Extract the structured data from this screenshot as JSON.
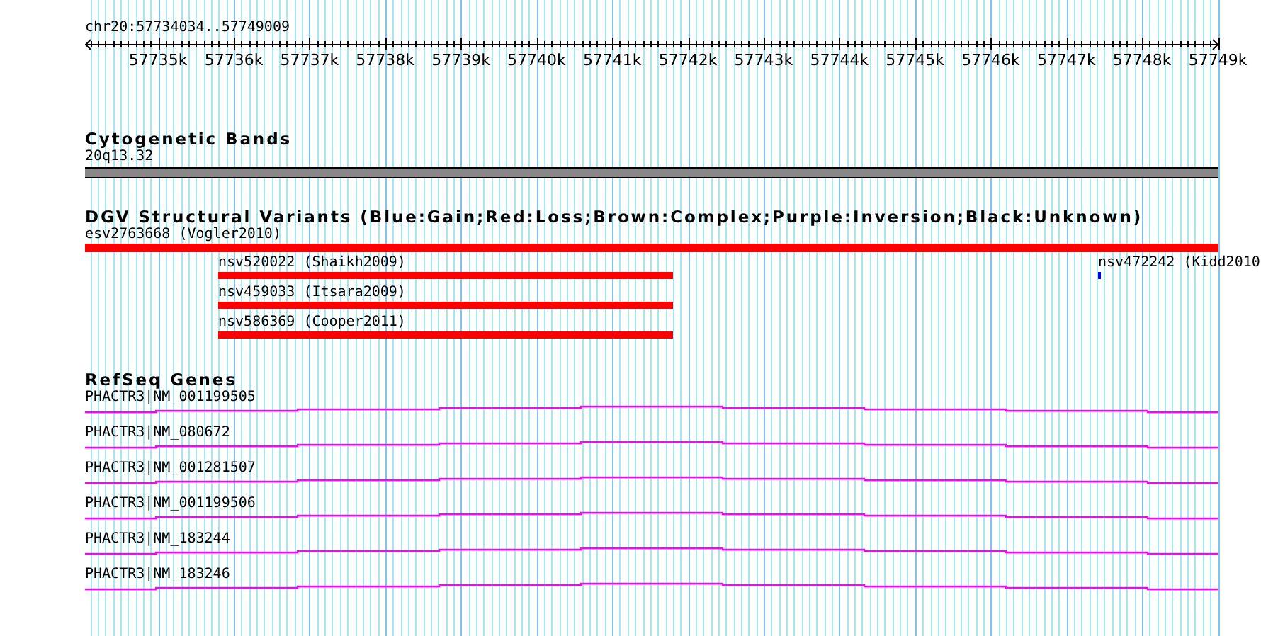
{
  "position": "chr20:57734034..57749009",
  "ruler": {
    "ticks": [
      "57735k",
      "57736k",
      "57737k",
      "57738k",
      "57739k",
      "57740k",
      "57741k",
      "57742k",
      "57743k",
      "57744k",
      "57745k",
      "57746k",
      "57747k",
      "57748k",
      "57749k"
    ]
  },
  "tracks": [
    {
      "kind": "bands",
      "title": "Cytogenetic Bands",
      "rows": [
        [
          {
            "label": "20q13.32"
          }
        ]
      ]
    },
    {
      "kind": "variants",
      "title": "DGV Structural Variants (Blue:Gain;Red:Loss;Brown:Complex;Purple:Inversion;Black:Unknown)",
      "rows": [
        [
          {
            "label": "esv2763668 (Vogler2010)",
            "color": "#ff0000"
          }
        ],
        [
          {
            "label": "nsv520022 (Shaikh2009)",
            "color": "#ff0000"
          },
          {
            "label": "nsv472242 (Kidd2010",
            "color": "#0000ff"
          }
        ],
        [
          {
            "label": "nsv459033 (Itsara2009)",
            "color": "#ff0000"
          }
        ],
        [
          {
            "label": "nsv586369 (Cooper2011)",
            "color": "#ff0000"
          }
        ]
      ]
    },
    {
      "kind": "genes",
      "title": "RefSeq Genes",
      "rows": [
        [
          {
            "label": "PHACTR3|NM_001199505"
          }
        ],
        [
          {
            "label": "PHACTR3|NM_080672"
          }
        ],
        [
          {
            "label": "PHACTR3|NM_001281507"
          }
        ],
        [
          {
            "label": "PHACTR3|NM_001199506"
          }
        ],
        [
          {
            "label": "PHACTR3|NM_183244"
          }
        ],
        [
          {
            "label": "PHACTR3|NM_183246"
          }
        ]
      ]
    }
  ]
}
